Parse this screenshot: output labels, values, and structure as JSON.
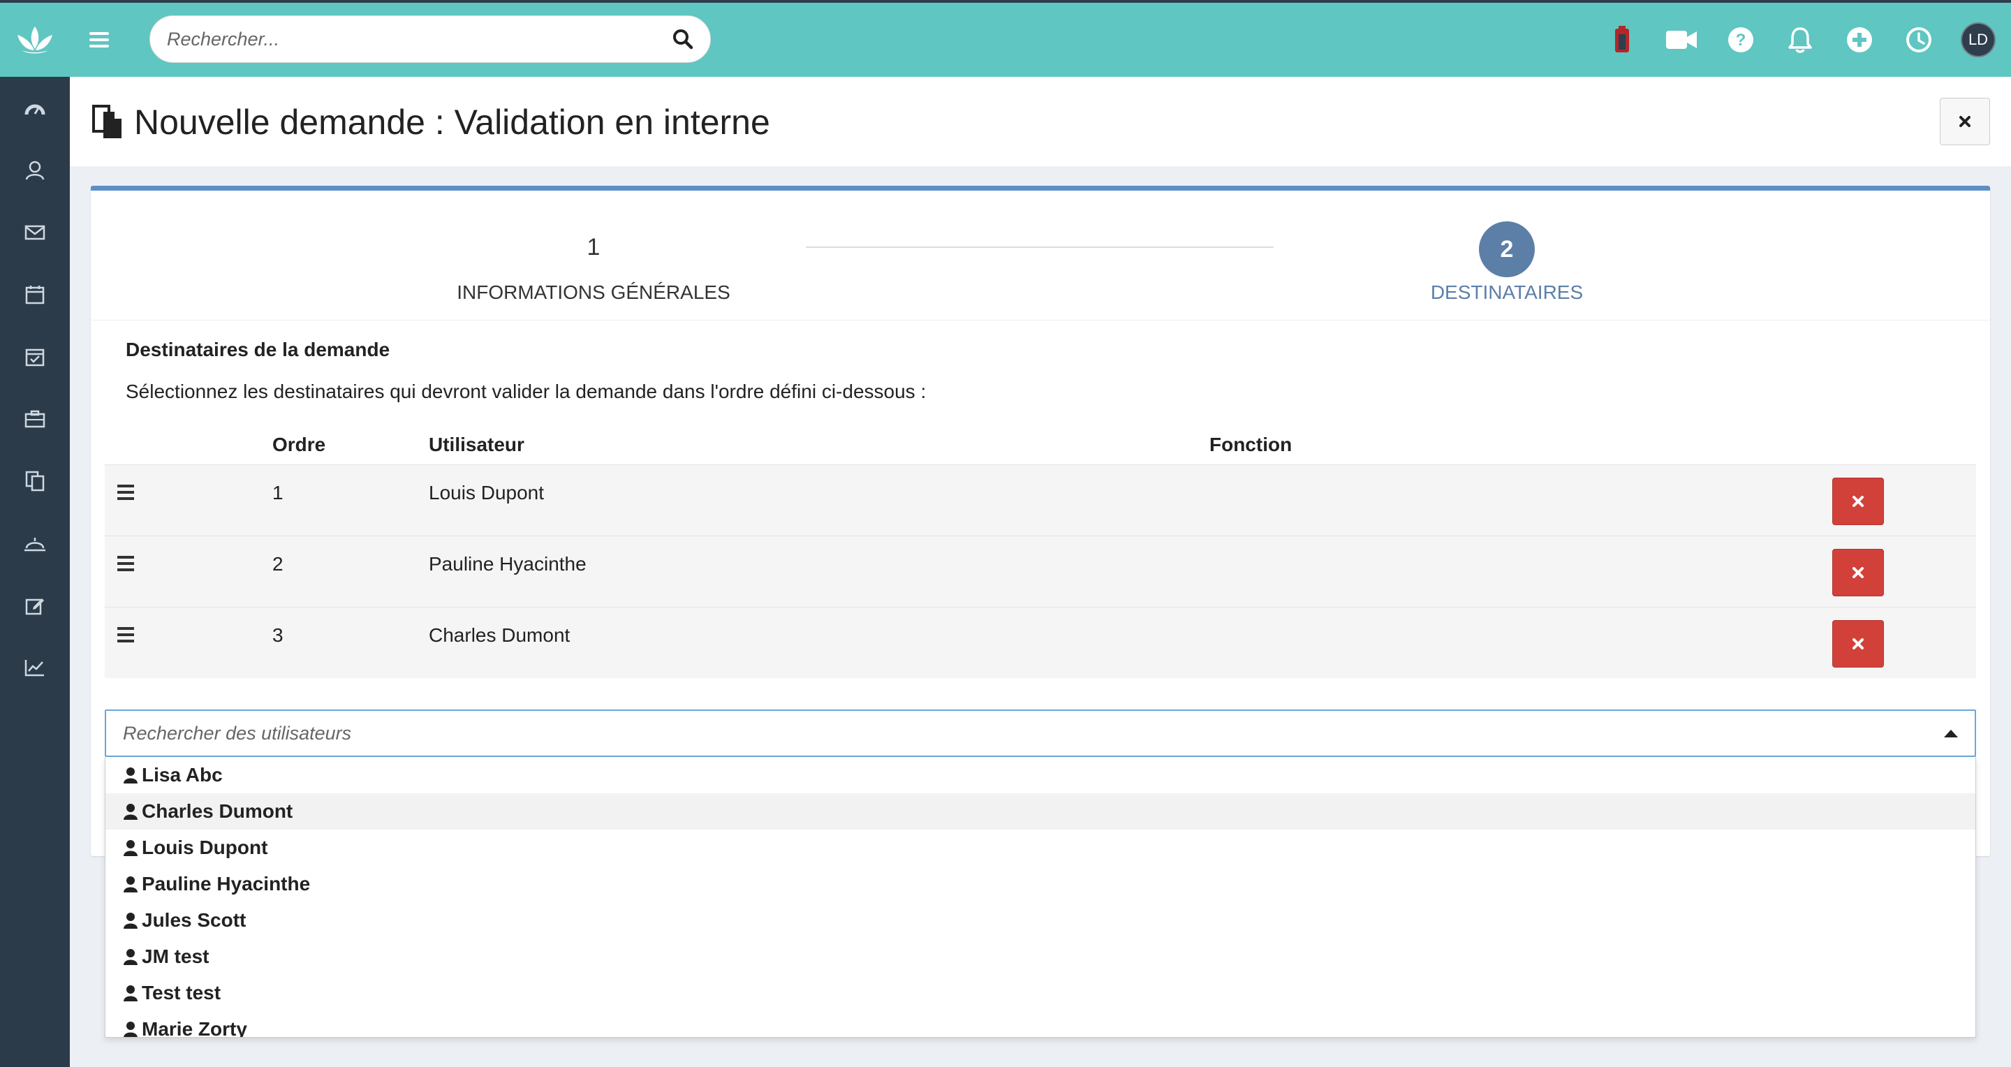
{
  "header": {
    "search_placeholder": "Rechercher...",
    "avatar_initials": "LD",
    "icons": [
      "battery-icon",
      "video-camera-icon",
      "help-icon",
      "bell-icon",
      "plus-circle-icon",
      "clock-icon"
    ]
  },
  "sidebar": {
    "items": [
      {
        "icon": "dashboard-icon"
      },
      {
        "icon": "contacts-icon"
      },
      {
        "icon": "mail-icon"
      },
      {
        "icon": "calendar-icon"
      },
      {
        "icon": "calendar-check-icon"
      },
      {
        "icon": "briefcase-icon"
      },
      {
        "icon": "documents-icon"
      },
      {
        "icon": "reception-bell-icon"
      },
      {
        "icon": "edit-icon"
      },
      {
        "icon": "chart-line-icon"
      }
    ]
  },
  "page": {
    "title": "Nouvelle demande : Validation en interne"
  },
  "steps": [
    {
      "number": "1",
      "label": "INFORMATIONS GÉNÉRALES",
      "active": false
    },
    {
      "number": "2",
      "label": "DESTINATAIRES",
      "active": true
    }
  ],
  "section": {
    "title": "Destinataires de la demande",
    "description": "Sélectionnez les destinataires qui devront valider la demande dans l'ordre défini ci-dessous :"
  },
  "table": {
    "columns": [
      "Ordre",
      "Utilisateur",
      "Fonction"
    ],
    "rows": [
      {
        "order": "1",
        "user": "Louis Dupont",
        "function": ""
      },
      {
        "order": "2",
        "user": "Pauline Hyacinthe",
        "function": ""
      },
      {
        "order": "3",
        "user": "Charles Dumont",
        "function": ""
      }
    ]
  },
  "user_select": {
    "placeholder": "Rechercher des utilisateurs",
    "options": [
      "Lisa Abc",
      "Charles Dumont",
      "Louis Dupont",
      "Pauline Hyacinthe",
      "Jules Scott",
      "JM test",
      "Test test",
      "Marie Zorty"
    ],
    "highlighted": "Charles Dumont"
  },
  "colors": {
    "topbar": "#5fc6c1",
    "sidebar": "#2c3b49",
    "accent": "#5c8fc5",
    "step_active": "#5c7fa8",
    "danger": "#d2403a"
  }
}
